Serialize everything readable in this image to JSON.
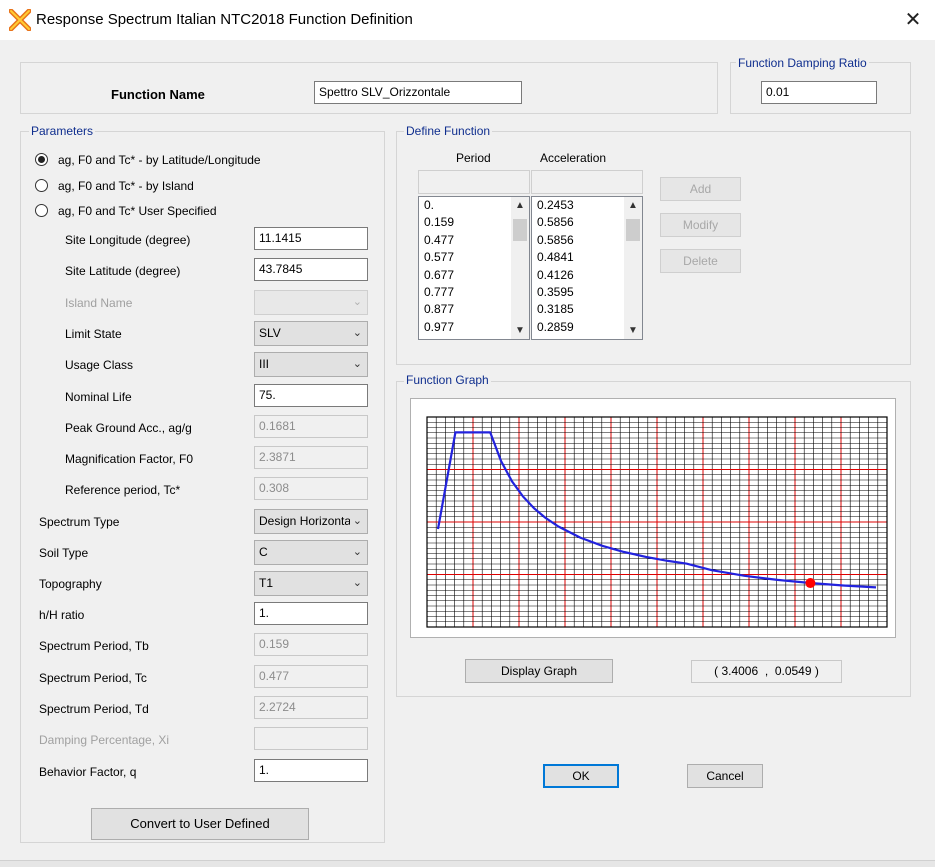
{
  "window": {
    "title": "Response Spectrum Italian NTC2018 Function Definition",
    "close_glyph": "✕"
  },
  "function_name": {
    "label": "Function Name",
    "value": "Spettro SLV_Orizzontale"
  },
  "damping": {
    "label": "Function Damping Ratio",
    "value": "0.01"
  },
  "parameters": {
    "label": "Parameters",
    "radios": [
      {
        "label": "ag, F0 and Tc* - by Latitude/Longitude",
        "checked": true
      },
      {
        "label": "ag, F0 and Tc* - by Island",
        "checked": false
      },
      {
        "label": "ag, F0 and Tc* User Specified",
        "checked": false
      }
    ],
    "site_longitude": {
      "label": "Site Longitude (degree)",
      "value": "11.1415"
    },
    "site_latitude": {
      "label": "Site Latitude (degree)",
      "value": "43.7845"
    },
    "island_name": {
      "label": "Island Name",
      "value": ""
    },
    "limit_state": {
      "label": "Limit State",
      "value": "SLV"
    },
    "usage_class": {
      "label": "Usage Class",
      "value": "III"
    },
    "nominal_life": {
      "label": "Nominal Life",
      "value": "75."
    },
    "peak_ground_acc": {
      "label": "Peak Ground Acc., ag/g",
      "value": "0.1681"
    },
    "magnification": {
      "label": "Magnification Factor, F0",
      "value": "2.3871"
    },
    "reference_period": {
      "label": "Reference period, Tc*",
      "value": "0.308"
    },
    "spectrum_type": {
      "label": "Spectrum Type",
      "value": "Design Horizontal"
    },
    "soil_type": {
      "label": "Soil Type",
      "value": "C"
    },
    "topography": {
      "label": "Topography",
      "value": "T1"
    },
    "hH_ratio": {
      "label": "h/H ratio",
      "value": "1."
    },
    "tb": {
      "label": "Spectrum Period, Tb",
      "value": "0.159"
    },
    "tc": {
      "label": "Spectrum Period, Tc",
      "value": "0.477"
    },
    "td": {
      "label": "Spectrum Period, Td",
      "value": "2.2724"
    },
    "damping_pct": {
      "label": "Damping Percentage, Xi",
      "value": ""
    },
    "behavior_factor": {
      "label": "Behavior Factor, q",
      "value": "1."
    },
    "convert_button": "Convert to User Defined"
  },
  "define_function": {
    "label": "Define Function",
    "period_header": "Period",
    "accel_header": "Acceleration",
    "periods": [
      "0.",
      "0.159",
      "0.477",
      "0.577",
      "0.677",
      "0.777",
      "0.877",
      "0.977"
    ],
    "accelerations": [
      "0.2453",
      "0.5856",
      "0.5856",
      "0.4841",
      "0.4126",
      "0.3595",
      "0.3185",
      "0.2859"
    ],
    "add_button": "Add",
    "modify_button": "Modify",
    "delete_button": "Delete"
  },
  "graph": {
    "label": "Function Graph",
    "display_button": "Display Graph",
    "coordinate_readout": "( 3.4006  ,  0.0549 )",
    "colors": {
      "curve": "#2222dd",
      "grid_minor": "#000000",
      "grid_major": "#dd0000",
      "marker": "#ff0000"
    }
  },
  "chart_data": {
    "type": "line",
    "title": "",
    "xlabel": "",
    "ylabel": "",
    "xlim": [
      -0.1,
      4.1
    ],
    "ylim": [
      -0.1,
      0.64
    ],
    "x": [
      0,
      0.159,
      0.477,
      0.577,
      0.677,
      0.777,
      0.877,
      0.977,
      1.1,
      1.3,
      1.5,
      1.7,
      1.9,
      2.1,
      2.2724,
      2.5,
      2.8,
      3.1,
      3.4,
      3.7,
      4.0
    ],
    "series": [
      {
        "values": [
          0.2453,
          0.5856,
          0.5856,
          0.4841,
          0.4126,
          0.3595,
          0.3185,
          0.2859,
          0.254,
          0.2149,
          0.1862,
          0.1643,
          0.147,
          0.133,
          0.1229,
          0.1002,
          0.0805,
          0.0659,
          0.0549,
          0.0463,
          0.0396
        ]
      }
    ],
    "marker_point": [
      3.4006,
      0.0549
    ],
    "grid": true
  },
  "actions": {
    "ok": "OK",
    "cancel": "Cancel"
  }
}
